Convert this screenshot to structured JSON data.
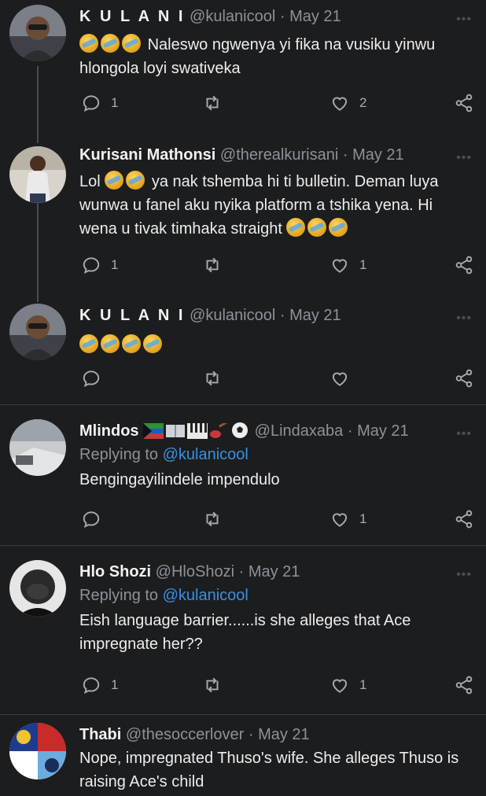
{
  "tweets": [
    {
      "name": "K U L A N I",
      "handle": "@kulanicool",
      "date": "May 21",
      "text": "Naleswo ngwenya yi fika na vusiku yinwu hlongola loyi swativeka",
      "emoji_prefix": 3,
      "replies": "1",
      "retweets": "",
      "likes": "2",
      "avatar": "avatar-kulani"
    },
    {
      "name": "Kurisani Mathonsi",
      "handle": "@therealkurisani",
      "date": "May 21",
      "text_before": "Lol",
      "text_after": "ya nak tshemba hi ti bulletin. Deman luya wunwa u fanel aku nyika platform a tshika yena. Hi wena u tivak timhaka straight",
      "replies": "1",
      "retweets": "",
      "likes": "1",
      "avatar": "avatar-kurisani"
    },
    {
      "name": "K U L A N I",
      "handle": "@kulanicool",
      "date": "May 21",
      "replies": "",
      "retweets": "",
      "likes": "",
      "avatar": "avatar-kulani"
    },
    {
      "name": "Mlindos",
      "handle": "@Lindaxaba",
      "date": "May 21",
      "replying_label": "Replying to",
      "replying_to": "@kulanicool",
      "text": "Bengingayilindele impendulo",
      "replies": "",
      "retweets": "",
      "likes": "1",
      "avatar": "avatar-mlindos"
    },
    {
      "name": "Hlo Shozi",
      "handle": "@HloShozi",
      "date": "May 21",
      "replying_label": "Replying to",
      "replying_to": "@kulanicool",
      "text": "Eish language barrier......is she alleges that Ace impregnate her??",
      "replies": "1",
      "retweets": "",
      "likes": "1",
      "avatar": "avatar-hlo"
    },
    {
      "name": "Thabi",
      "handle": "@thesoccerlover",
      "date": "May 21",
      "text": "Nope, impregnated Thuso's wife. She alleges Thuso is raising Ace's child",
      "avatar": "avatar-thabi"
    }
  ],
  "icons": {
    "reply": "reply-icon",
    "retweet": "retweet-icon",
    "like": "heart-icon",
    "share": "share-icon",
    "more": "more-icon"
  },
  "colors": {
    "background": "#1c1d1f",
    "mention": "#3b8fe0",
    "secondary_text": "#8e9197"
  }
}
